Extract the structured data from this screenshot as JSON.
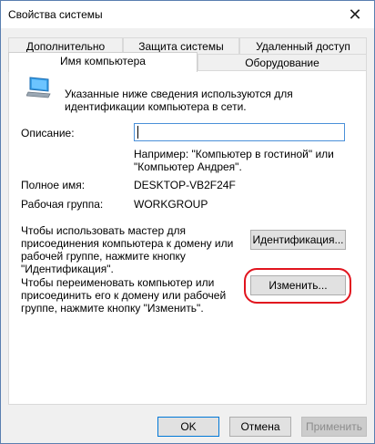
{
  "window": {
    "title": "Свойства системы",
    "close_glyph": "✕"
  },
  "tabs": {
    "row1": [
      "Дополнительно",
      "Защита системы",
      "Удаленный доступ"
    ],
    "row2": [
      "Имя компьютера",
      "Оборудование"
    ],
    "active": "Имя компьютера"
  },
  "panel": {
    "intro_text": "Указанные ниже сведения используются для\nидентификации компьютера в сети.",
    "description_label": "Описание:",
    "description_value": "",
    "example_text": "Например: \"Компьютер в гостиной\" или\n\"Компьютер Андрея\".",
    "fullname_label": "Полное имя:",
    "fullname_value": "DESKTOP-VB2F24F",
    "workgroup_label": "Рабочая группа:",
    "workgroup_value": "WORKGROUP",
    "network_id_text": "Чтобы использовать мастер для\nприсоединения компьютера к домену или\nрабочей группе, нажмите кнопку\n\"Идентификация\".",
    "network_id_button": "Идентификация...",
    "rename_text": "Чтобы переименовать компьютер или\nприсоединить его к домену или рабочей\nгруппе, нажмите кнопку \"Изменить\".",
    "rename_button": "Изменить...",
    "icon": "computer-monitor-icon"
  },
  "footer": {
    "ok": "OK",
    "cancel": "Отмена",
    "apply": "Применить"
  },
  "colors": {
    "highlight": "#e1141e",
    "focus_border": "#0078d7"
  }
}
